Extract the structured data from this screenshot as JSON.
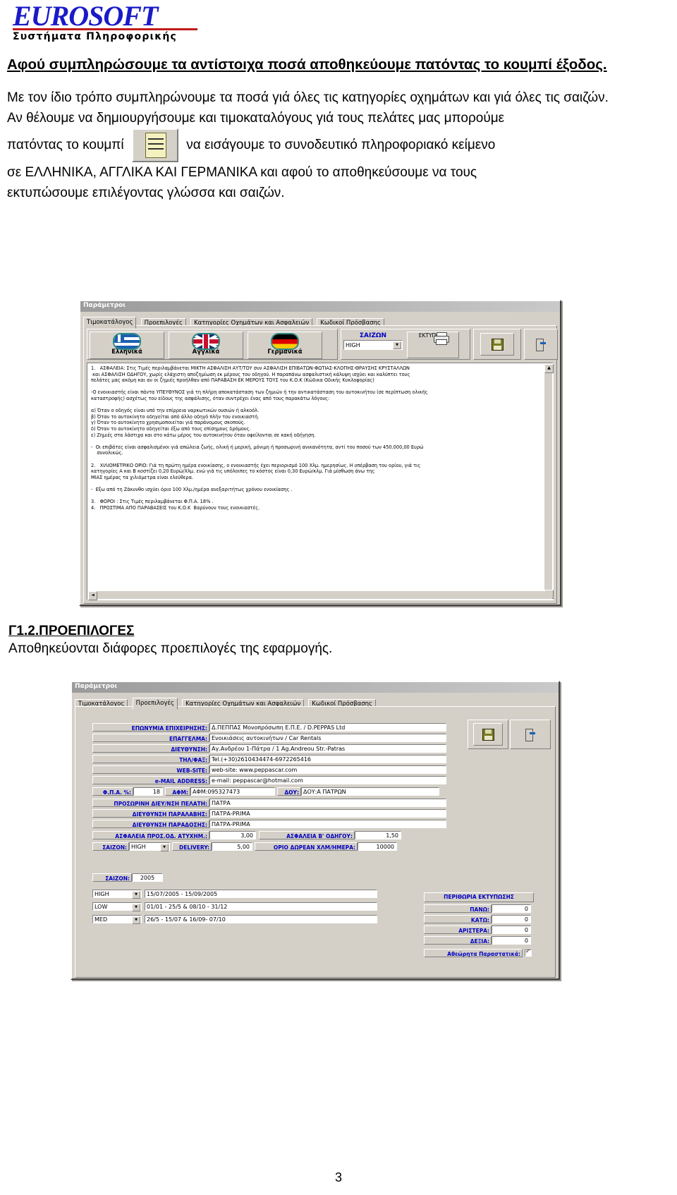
{
  "logo": {
    "word_euro": "EURO",
    "word_soft": "SOFT",
    "tagline": "Συστήματα  Πληροφορικής"
  },
  "document": {
    "para_bold": "Αφού συμπληρώσουμε τα αντίστοιχα ποσά αποθηκεύουμε πατόντας το κουμπί έξοδος.",
    "para_2": "Με τον ίδιο τρόπο συμπληρώνουμε τα ποσά γιά όλες τις κατηγορίες οχημάτων και γιά όλες τις σαιζών.",
    "para_3": "Αν θέλουμε να δημιουργήσουμε και τιμοκαταλόγους γιά τους πελάτες μας μπορούμε",
    "para_4_before": "πατόντας το κουμπί",
    "para_4_after": "να εισάγουμε το συνοδευτικό πληροφοριακό κείμενο",
    "para_5": "σε ΕΛΛΗΝΙΚΑ, ΑΓΓΛΙΚΑ ΚΑΙ ΓΕΡΜΑΝΙΚΑ και αφού το αποθηκεύσουμε να τους",
    "para_6": "εκτυπώσουμε επιλέγοντας γλώσσα και σαιζών.",
    "section_heading": "Γ1.2.ΠΡΟΕΠΙΛΟΓΕΣ",
    "section_body": "Αποθηκεύονται διάφορες προεπιλογές της εφαρμογής.",
    "page_number": "3"
  },
  "dialog1": {
    "title": "Παράμετροι",
    "tabs": [
      {
        "label": "Τιμοκατάλογος",
        "selected": true
      },
      {
        "label": "Προεπιλογές",
        "selected": false
      },
      {
        "label": "Κατηγορίες Οχημάτων και Ασφαλειών",
        "selected": false
      },
      {
        "label": "Κωδικοί Πρόσβασης",
        "selected": false
      }
    ],
    "lang_buttons": [
      {
        "label": "Ελληνικά",
        "flag": "greece-flag-icon"
      },
      {
        "label": "Αγγλικά",
        "flag": "uk-flag-icon"
      },
      {
        "label": "Γερμανικά",
        "flag": "germany-flag-icon"
      }
    ],
    "season_label": "ΣΑΙΖΩΝ",
    "season_value": "HIGH",
    "print_label": "ΕΚΤΥΠΩΣΗ",
    "save_icon": "floppy-disk-icon",
    "exit_icon": "exit-door-icon",
    "text_body": "1.   ΑΣΦΑΛΕΙΑ: Στις Τιμές περιλαμβάνεται ΜΙΚΤΗ ΑΣΦΑΛΙΣΗ ΑΥΤ/ΤΟΥ συν ΑΣΦΑΛΙΣΗ ΕΠΙΒΑΤΩΝ-ΦΩΤΙΑΣ-ΚΛΟΠΗΣ-ΘΡΑΥΣΗΣ ΚΡΥΣΤΑΛΛΩΝ\n και ΑΣΦΑΛΙΣΗ ΟΔΗΓΟΥ, χωρίς ελάχιστη αποζημίωση εκ μέρους του οδηγού. Η παραπάνω ασφαλιστική κάλυψη ισχύει και καλύπτει τους\nπελάτες μας ακόμη και αν οι ζημιές προήλθαν από ΠΑΡΑΒΑΣΗ ΕΚ ΜΕΡΟΥΣ ΤΟΥΣ του Κ.Ο.Κ (Κώδικα Οδικής Κυκλοφορίας)\n\n-Ο ενοικιαστής είναι πάντα ΥΠΕΥΘΥΝΟΣ γιά τη πλήρη αποκατάσταση των ζημιών ή την αντικατάσταση του αυτοκινήτου (σε περίπτωση ολικής\nκαταστροφής) ασχέτως του είδους της ασφάλισης, όταν συντρέχει ένας από τους παρακάτω λόγους:\n\nα) Όταν ο οδηγός είναι υπό την επίρρεια ναρκωτικών ουσιών ή αλκοόλ.\nβ) Όταν το αυτοκίνητο οδηγείται από άλλο οδηγό πλήν του ενοικιαστή.\nγ) Όταν το αυτοκίνητο χρησιμοποιείται γιά παράνομους σκοπούς.\nδ) Όταν το αυτοκίνητο οδηγείται έξω από τους επίσημους δρόμους.\nε) Ζημιές στα λάστιχα και στο κάτω μέρος του αυτοκινήτου όταν οφείλονται σε κακή οδήγηση.\n\n-  Οι επιβάτες είναι ασφαλισμένοι γιά απώλεια ζωής, ολική ή μερική, μόνιμη ή προσωρινή ανικανότητα, αντί του ποσού των 450.000,00 Ευρώ\n    συνολικώς.\n\n2.   ΧΙΛΙΟΜΕΤΡΙΚΟ ΟΡΙΟ: Γιά τη πρώτη ημέρα ενοικίασης, ο ενοικιαστής έχει περιορισμό 100 Χλμ. ημερησίως. Η υπέρβαση του ορίου, γιά τις\nκατηγορίες Α και Β κοστίζει 0,20 Ευρώ/Χλμ. ενώ γιά τις υπόλοιπες το κόστος είναι 0,30 Ευρώ/κλμ. Γιά μίσθωση άνω της\nΜΙΑΣ ημέρας τα χιλιόμετρα είναι ελεύθερα.\n\n-  Εξω από τη Ζάκυνθο ισχύει όριο 100 Χλμ./ημέρα ανεξαριτήτως χρόνου ενοικίασης .\n\n3.   ΦΟΡΟΙ : Στις Τιμές περιλαμβάνεται Φ.Π.Α. 18% .\n4.   ΠΡΟΣΤΙΜΑ ΑΠΟ ΠΑΡΑΒΑΣΕΙΣ του Κ.Ο.Κ  Βαρύνουν τους ενοικιαστές."
  },
  "dialog2": {
    "title": "Παράμετροι",
    "tabs": [
      {
        "label": "Τιμοκατάλογος",
        "selected": false
      },
      {
        "label": "Προεπιλογές",
        "selected": true
      },
      {
        "label": "Κατηγορίες Οχημάτων και Ασφαλειών",
        "selected": false
      },
      {
        "label": "Κωδικοί Πρόσβασης",
        "selected": false
      }
    ],
    "fields": [
      {
        "label": "ΕΠΩΝΥΜΙΑ ΕΠΙΧΕΙΡΗΣΗΣ:",
        "value": "Δ.ΠΕΠΠΑΣ Μονοπρόσωπη Ε.Π.Ε. / D.PEPPAS Ltd"
      },
      {
        "label": "ΕΠΑΓΓΕΛΜΑ:",
        "value": "Ενοικιάσεις αυτοκινήτων / Car Rentals"
      },
      {
        "label": "ΔΙΕΥΘΥΝΣΗ:",
        "value": "Αγ.Ανδρέου 1-Πάτρα / 1 Ag.Andreou Str.-Patras"
      },
      {
        "label": "ΤΗΛ/ΦΑΞ:",
        "value": "Tel.(+30)2610434474-6972265416"
      },
      {
        "label": "WEB-SITE:",
        "value": "web-site: www.peppascar.com"
      },
      {
        "label": "e-MAIL ADDRESS:",
        "value": "e-mail: peppascar@hotmail.com"
      }
    ],
    "tax_row": {
      "fpa_label": "Φ.Π.Α. %:",
      "fpa_value": "18",
      "afm_label": "ΑΦΜ:",
      "afm_value": "ΑΦΜ:095327473",
      "doy_label": "ΔΟΥ:",
      "doy_value": "ΔΟΥ:Α ΠΑΤΡΩΝ"
    },
    "address_fields": [
      {
        "label": "ΠΡΟΣΩΡΙΝΗ ΔΙΕΥ/ΝΣΗ ΠΕΛΑΤΗ:",
        "value": "ΠΑΤΡΑ"
      },
      {
        "label": "ΔΙΕΥΘΥΝΣΗ ΠΑΡΑΛΑΒΗΣ:",
        "value": "ΠΑΤΡΑ-PRIMA"
      },
      {
        "label": "ΔΙΕΥΘΥΝΣΗ ΠΑΡΑΔΟΣΗΣ:",
        "value": "ΠΑΤΡΑ-PRIMA"
      }
    ],
    "insurance_row": {
      "left_label": "ΑΣΦΑΛΕΙΑ ΠΡΟΣ.ΟΔ. ΑΤΥΧΗΜ.:",
      "left_value": "3,00",
      "right_label": "ΑΣΦΑΛΕΙΑ Β' ΟΔΗΓΟΥ:",
      "right_value": "1,50"
    },
    "season_row": {
      "season_label": "ΣΑΙΖΟΝ:",
      "season_value": "HIGH",
      "delivery_label": "DELIVERY:",
      "delivery_value": "5,00",
      "limit_label": "ΟΡΙΟ ΔΩΡΕΑΝ ΧΛΜ/ΗΜΕΡΑ:",
      "limit_value": "10000"
    },
    "year_row": {
      "label": "ΣΑΙΖΟΝ:",
      "value": "2005"
    },
    "season_table": [
      {
        "name": "HIGH",
        "range": "15/07/2005 - 15/09/2005"
      },
      {
        "name": "LOW",
        "range": "01/01 - 25/5 &  08/10 - 31/12"
      },
      {
        "name": "MED",
        "range": "26/5 - 15/07 & 16/09- 07/10"
      }
    ],
    "margins": {
      "title": "ΠΕΡΙΘΩΡΙΑ ΕΚΤΥΠΩΣΗΣ",
      "rows": [
        {
          "label": "ΠΑΝΩ:",
          "value": "0"
        },
        {
          "label": "ΚΑΤΩ:",
          "value": "0"
        },
        {
          "label": "ΑΡΙΣΤΕΡΑ:",
          "value": "0"
        },
        {
          "label": "ΔΕΞΙΑ:",
          "value": "0"
        }
      ],
      "checkbox_label": "Αθεώρητα Παραστατικά:"
    },
    "save_icon": "floppy-disk-icon",
    "exit_icon": "exit-door-icon"
  }
}
